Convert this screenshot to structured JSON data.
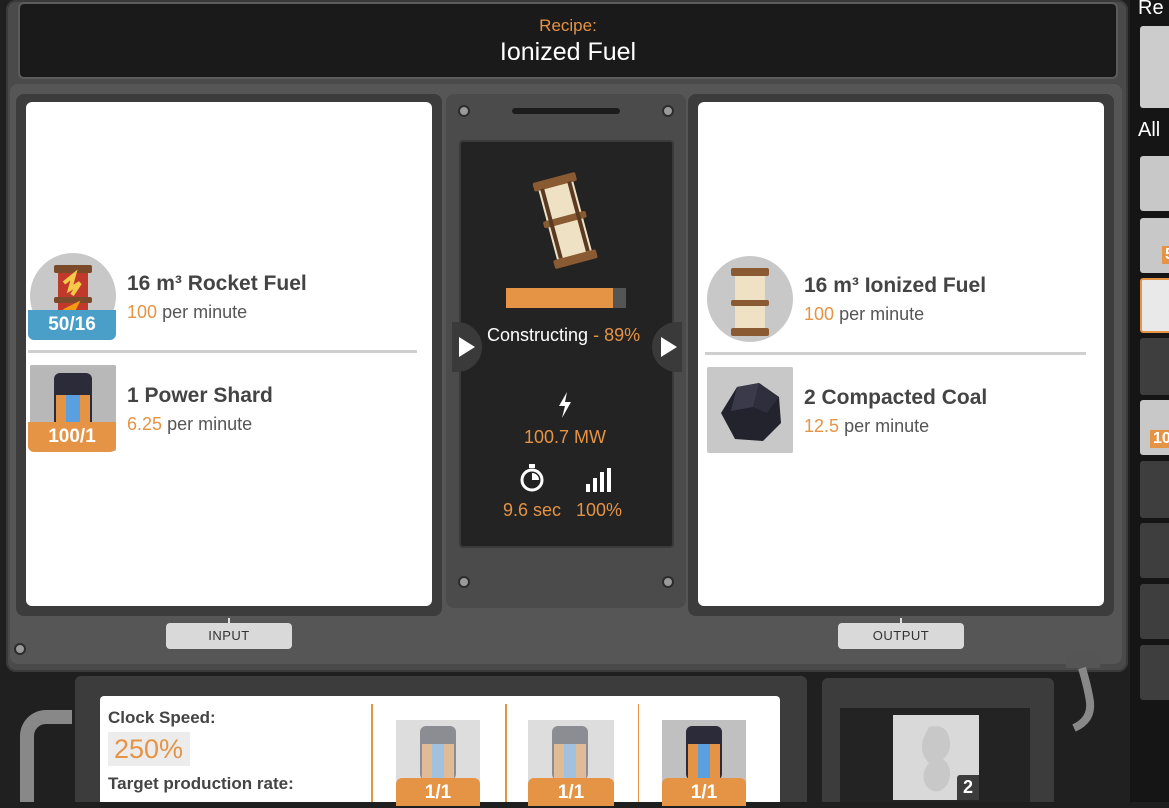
{
  "header": {
    "recipe_label": "Recipe:",
    "recipe_name": "Ionized Fuel"
  },
  "inputs": [
    {
      "name": "16 m³ Rocket Fuel",
      "rate": "100",
      "rate_suffix": "per minute",
      "badge": "50/16",
      "badge_color": "#4a9fc8",
      "icon": "rocket-fuel-icon"
    },
    {
      "name": "1 Power Shard",
      "rate": "6.25",
      "rate_suffix": "per minute",
      "badge": "100/1",
      "badge_color": "#e59345",
      "icon": "power-shard-icon"
    }
  ],
  "outputs": [
    {
      "name": "16 m³ Ionized Fuel",
      "rate": "100",
      "rate_suffix": "per minute",
      "icon": "ionized-fuel-icon"
    },
    {
      "name": "2 Compacted Coal",
      "rate": "12.5",
      "rate_suffix": "per minute",
      "icon": "compacted-coal-icon"
    }
  ],
  "center": {
    "status": "Constructing",
    "separator": " - ",
    "percent": "89%",
    "progress": 0.89,
    "power": "100.7 MW",
    "cycle_time": "9.6 sec",
    "productivity": "100%"
  },
  "tabs": {
    "input": "INPUT",
    "output": "OUTPUT"
  },
  "sidebar": {
    "recipes_label": "Re",
    "all_label": "All",
    "slot_badge_1": "5",
    "slot_badge_2": "10"
  },
  "bottom": {
    "clock_label": "Clock Speed:",
    "clock_value": "250%",
    "target_label": "Target production rate:",
    "shards": [
      "1/1",
      "1/1",
      "1/1"
    ],
    "somersloop_count": "2"
  },
  "colors": {
    "accent": "#e59345",
    "blue_badge": "#4a9fc8"
  }
}
